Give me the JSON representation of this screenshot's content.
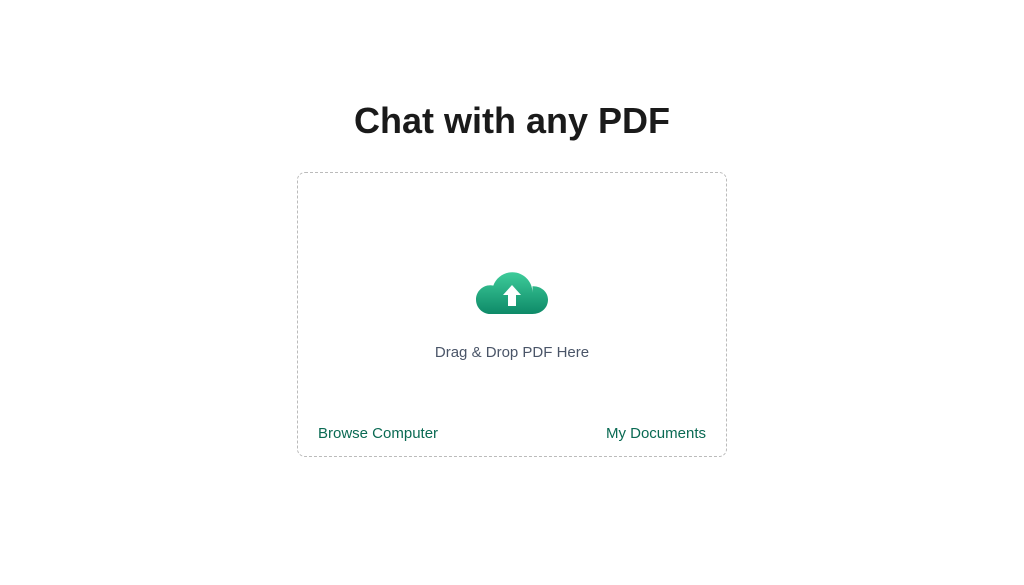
{
  "header": {
    "title": "Chat with any PDF"
  },
  "upload": {
    "dropzone_text": "Drag & Drop PDF Here",
    "browse_label": "Browse Computer",
    "documents_label": "My Documents"
  },
  "colors": {
    "accent": "#0a6a53",
    "cloud_start": "#2db889",
    "cloud_end": "#0e8a68"
  }
}
